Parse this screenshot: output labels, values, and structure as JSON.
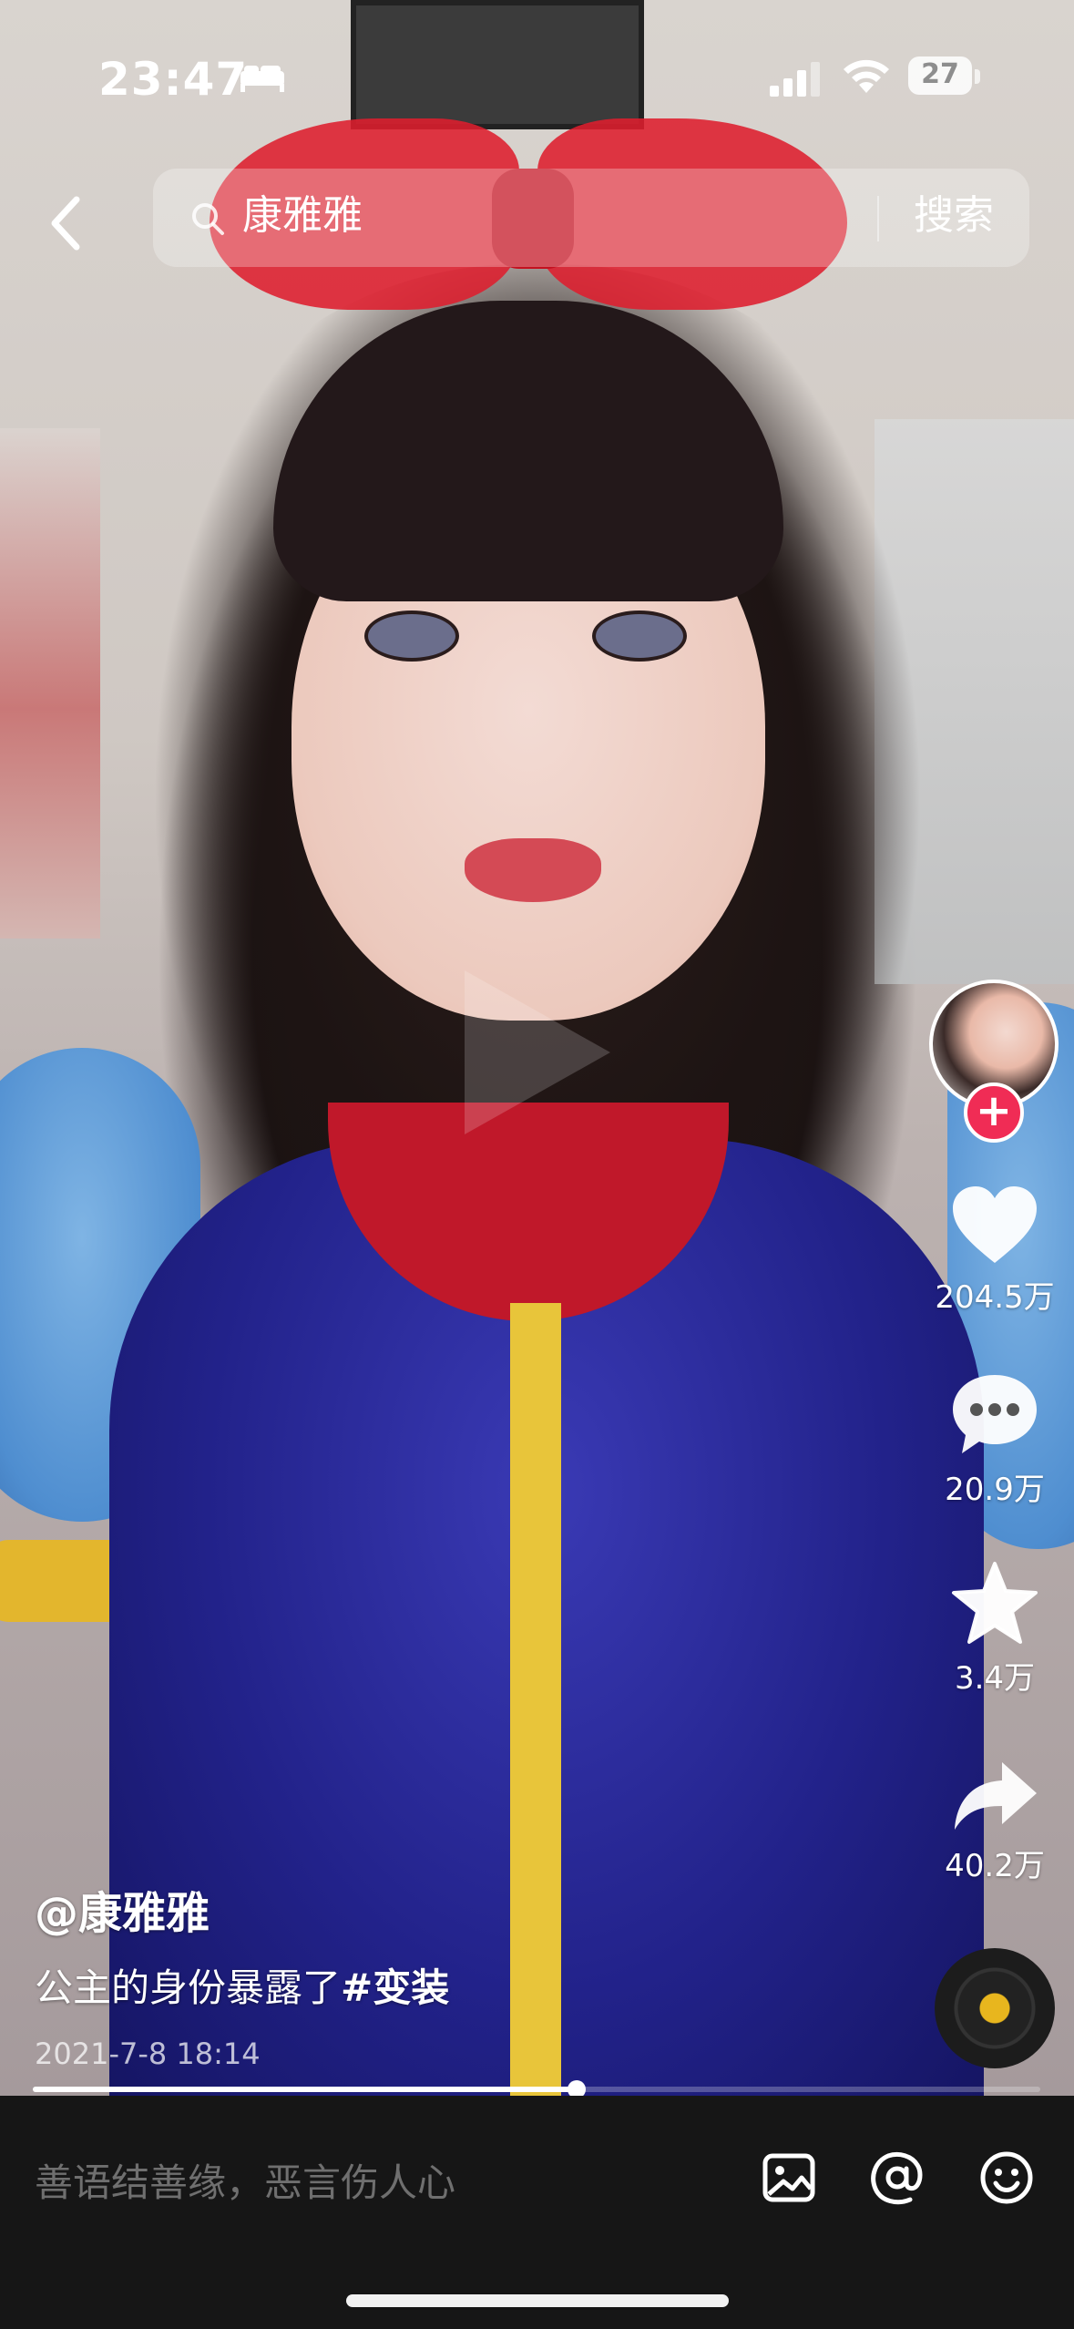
{
  "status_bar": {
    "time": "23:47",
    "battery": "27"
  },
  "search": {
    "query": "康雅雅",
    "button_label": "搜索"
  },
  "right_rail": {
    "likes": "204.5万",
    "comments": "20.9万",
    "favorites": "3.4万",
    "shares": "40.2万",
    "follow_symbol": "+"
  },
  "caption": {
    "author": "@康雅雅",
    "description_text": "公主的身份暴露了",
    "hashtag": "#变装",
    "date": "2021-7-8 18:14"
  },
  "progress": {
    "fraction": 0.54
  },
  "comment_bar": {
    "placeholder": "善语结善缘，恶言伤人心"
  },
  "colors": {
    "follow_red": "#f02c55",
    "comment_bar_bg": "#161616"
  }
}
